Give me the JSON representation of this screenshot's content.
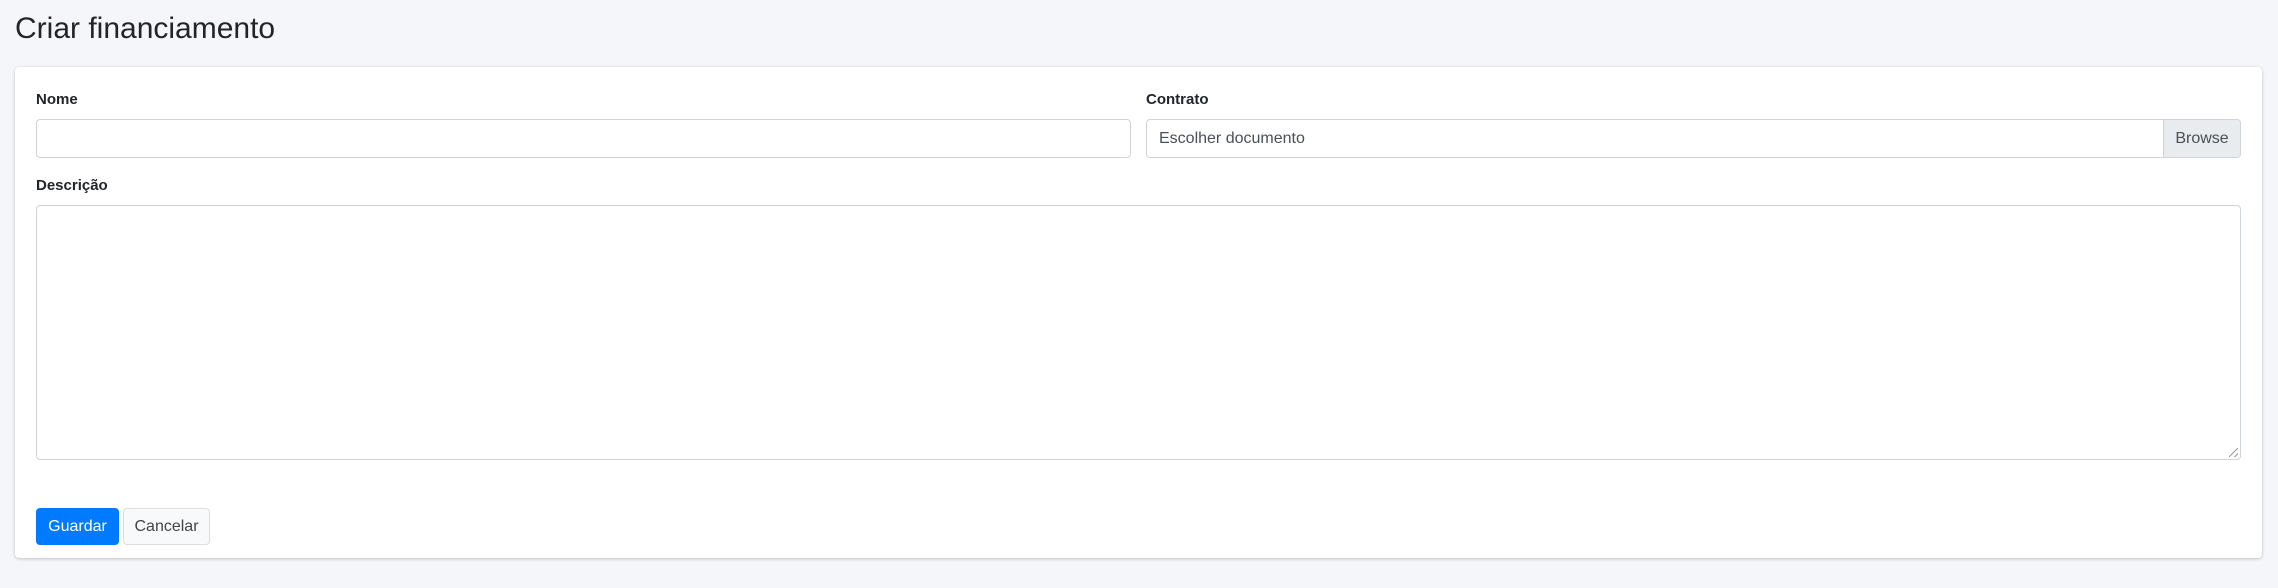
{
  "page": {
    "title": "Criar financiamento"
  },
  "form": {
    "nome_label": "Nome",
    "nome_value": "",
    "contrato_label": "Contrato",
    "contrato_placeholder": "Escolher documento",
    "browse_label": "Browse",
    "descricao_label": "Descrição",
    "descricao_value": ""
  },
  "actions": {
    "save_label": "Guardar",
    "cancel_label": "Cancelar"
  },
  "colors": {
    "primary": "#007bff",
    "background": "#f4f6f9"
  }
}
